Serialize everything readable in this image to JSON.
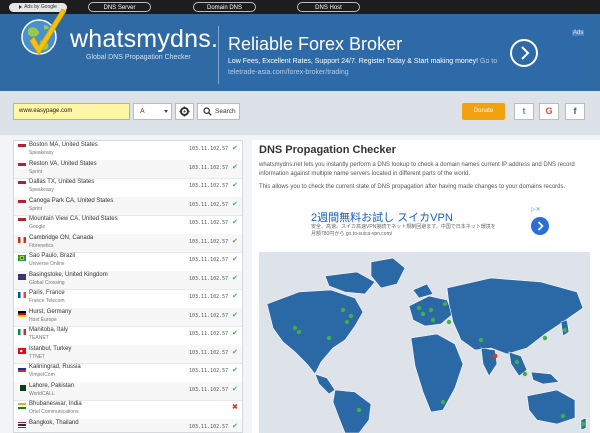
{
  "topbar": {
    "ads_label": "Ads by Google",
    "nav": [
      "DNS Server",
      "Domain DNS",
      "DNS Host"
    ]
  },
  "header": {
    "site_name": "whatsmydns.net",
    "tagline": "Global DNS Propagation Checker"
  },
  "banner_ad": {
    "title": "Reliable Forex Broker",
    "description": "Low Fees, Excellent Rates, Support 24/7. Register Today & Start making money!",
    "url_text": "Go to teletrade-asia.com/forex-broker/trading",
    "ad_choices": "Ads"
  },
  "search": {
    "domain_value": "www.easypage.com",
    "record_type": "A",
    "search_label": "Search",
    "donate_label": "Donate",
    "social": [
      "twitter-icon",
      "google-plus-icon",
      "facebook-icon"
    ]
  },
  "colors": {
    "header_blue": "#2f6aa4",
    "ok_green": "#3eb04a",
    "fail_red": "#d93b2b",
    "donate_orange": "#f2a20f"
  },
  "servers": [
    {
      "location": "Boston MA, United States",
      "isp": "Speakeasy",
      "ip": "103.11.102.57",
      "status": "ok",
      "flag": "us"
    },
    {
      "location": "Reston VA, United States",
      "isp": "Sprint",
      "ip": "103.11.102.57",
      "status": "ok",
      "flag": "us"
    },
    {
      "location": "Dallas TX, United States",
      "isp": "Speakeasy",
      "ip": "103.11.102.57",
      "status": "ok",
      "flag": "us"
    },
    {
      "location": "Canoga Park CA, United States",
      "isp": "Sprint",
      "ip": "103.11.102.57",
      "status": "ok",
      "flag": "us"
    },
    {
      "location": "Mountain View CA, United States",
      "isp": "Google",
      "ip": "103.11.102.57",
      "status": "ok",
      "flag": "us"
    },
    {
      "location": "Cambridge ON, Canada",
      "isp": "Fibrenetics",
      "ip": "103.11.102.57",
      "status": "ok",
      "flag": "ca"
    },
    {
      "location": "Sao Paulo, Brazil",
      "isp": "Universe Online",
      "ip": "103.11.102.57",
      "status": "ok",
      "flag": "br"
    },
    {
      "location": "Basingstoke, United Kingdom",
      "isp": "Global Crossing",
      "ip": "103.11.102.57",
      "status": "ok",
      "flag": "gb"
    },
    {
      "location": "Paris, France",
      "isp": "France Telecom",
      "ip": "103.11.102.57",
      "status": "ok",
      "flag": "fr"
    },
    {
      "location": "Hurst, Germany",
      "isp": "Host Europe",
      "ip": "103.11.102.57",
      "status": "ok",
      "flag": "de"
    },
    {
      "location": "Manitoba, Italy",
      "isp": "TEANET",
      "ip": "103.11.102.57",
      "status": "ok",
      "flag": "it"
    },
    {
      "location": "Istanbul, Turkey",
      "isp": "TTNET",
      "ip": "103.11.102.57",
      "status": "ok",
      "flag": "tr"
    },
    {
      "location": "Kaliningrad, Russia",
      "isp": "VimpelCom",
      "ip": "103.11.102.57",
      "status": "ok",
      "flag": "ru"
    },
    {
      "location": "Lahore, Pakistan",
      "isp": "WorldCALL",
      "ip": "103.11.102.57",
      "status": "ok",
      "flag": "pk"
    },
    {
      "location": "Bhubaneswar, India",
      "isp": "Ortel Communications",
      "ip": "",
      "status": "fail",
      "flag": "in"
    },
    {
      "location": "Bangkok, Thailand",
      "isp": "",
      "ip": "103.11.102.57",
      "status": "ok",
      "flag": "th"
    }
  ],
  "main": {
    "title": "DNS Propagation Checker",
    "para1": "whatsmydns.net lets you instantly perform a DNS lookup to check a domain names current IP address and DNS record information against multiple name servers located in different parts of the world.",
    "para2": "This allows you to check the current state of DNS propagation after having made changes to your domains records."
  },
  "vpn_ad": {
    "title": "2週間無料お試し スイカVPN",
    "description": "安全、高速、スイカ高速VPN接続でネット規制回避ます。中国で日本ネット環境を月額780円から go.to-suica-vpn.com/",
    "ad_choices": "▷✕"
  }
}
